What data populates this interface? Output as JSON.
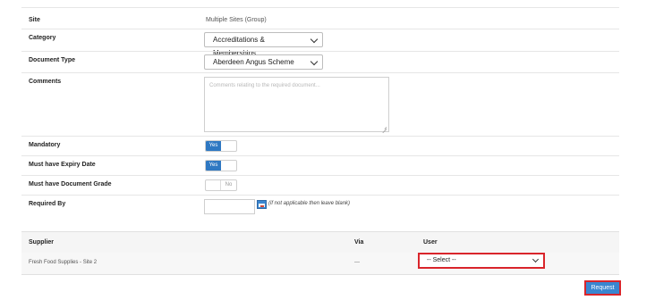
{
  "form": {
    "site": {
      "label": "Site",
      "value": "Multiple Sites (Group)"
    },
    "category": {
      "label": "Category",
      "value": "Accreditations & Memberships"
    },
    "document_type": {
      "label": "Document Type",
      "value": "Aberdeen Angus Scheme"
    },
    "comments": {
      "label": "Comments",
      "placeholder": "Comments relating to the required document..."
    },
    "mandatory": {
      "label": "Mandatory",
      "toggle_label": "Yes",
      "checked": true
    },
    "expiry": {
      "label": "Must have Expiry Date",
      "toggle_label": "Yes",
      "checked": true
    },
    "grade": {
      "label": "Must have Document Grade",
      "toggle_label": "No",
      "checked": false
    },
    "required_by": {
      "label": "Required By",
      "hint": "(if not applicable then leave blank)"
    }
  },
  "table": {
    "headers": {
      "supplier": "Supplier",
      "via": "Via",
      "user": "User"
    },
    "rows": [
      {
        "supplier": "Fresh Food Supplies - Site 2",
        "via": "---",
        "user_select": "-- Select --"
      }
    ]
  },
  "actions": {
    "request_label": "Request"
  },
  "colors": {
    "accent": "#2f78c2",
    "highlight": "#d9252b"
  }
}
